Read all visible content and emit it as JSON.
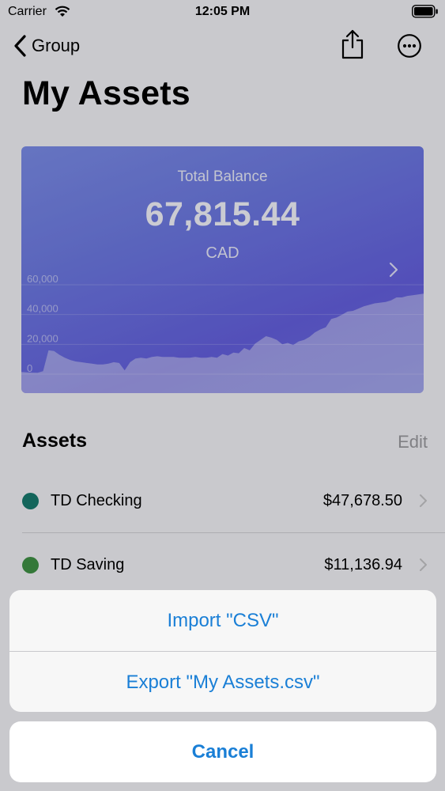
{
  "status_bar": {
    "carrier": "Carrier",
    "time": "12:05 PM"
  },
  "nav": {
    "back_label": "Group"
  },
  "page": {
    "title": "My Assets"
  },
  "balance_card": {
    "label": "Total Balance",
    "amount": "67,815.44",
    "currency": "CAD",
    "gradient_colors": [
      "#7b8de8",
      "#6460df"
    ]
  },
  "chart_data": {
    "type": "area",
    "y_ticks": [
      "0",
      "20,000",
      "40,000",
      "60,000"
    ],
    "ylim": [
      0,
      60000
    ],
    "grid": true,
    "series": [
      {
        "values": [
          1500,
          1200,
          1000,
          900,
          2000,
          16000,
          15500,
          13000,
          11000,
          9500,
          8500,
          8000,
          7500,
          7000,
          6500,
          6500,
          7000,
          8000,
          7500,
          2500,
          8000,
          10500,
          11000,
          10500,
          11500,
          12000,
          11500,
          11500,
          11500,
          11000,
          11000,
          11000,
          11500,
          11000,
          11000,
          11500,
          11000,
          13500,
          12500,
          14500,
          14000,
          17500,
          16000,
          20500,
          23000,
          25500,
          24500,
          23000,
          20000,
          21000,
          19500,
          22000,
          23000,
          25000,
          28000,
          30000,
          31500,
          37000,
          38000,
          40000,
          42000,
          42500,
          44000,
          45500,
          46500,
          47500,
          48000,
          48500,
          49500,
          51500,
          51500,
          52500,
          53000,
          53500,
          54000
        ]
      }
    ]
  },
  "assets": {
    "title": "Assets",
    "edit_label": "Edit",
    "items": [
      {
        "name": "TD Checking",
        "value": "$47,678.50",
        "color": "#177a6e"
      },
      {
        "name": "TD Saving",
        "value": "$11,136.94",
        "color": "#3f9145"
      }
    ]
  },
  "action_sheet": {
    "actions": [
      {
        "label": "Import \"CSV\""
      },
      {
        "label": "Export \"My Assets.csv\""
      }
    ],
    "cancel_label": "Cancel",
    "tint_color": "#1a7fd6"
  }
}
